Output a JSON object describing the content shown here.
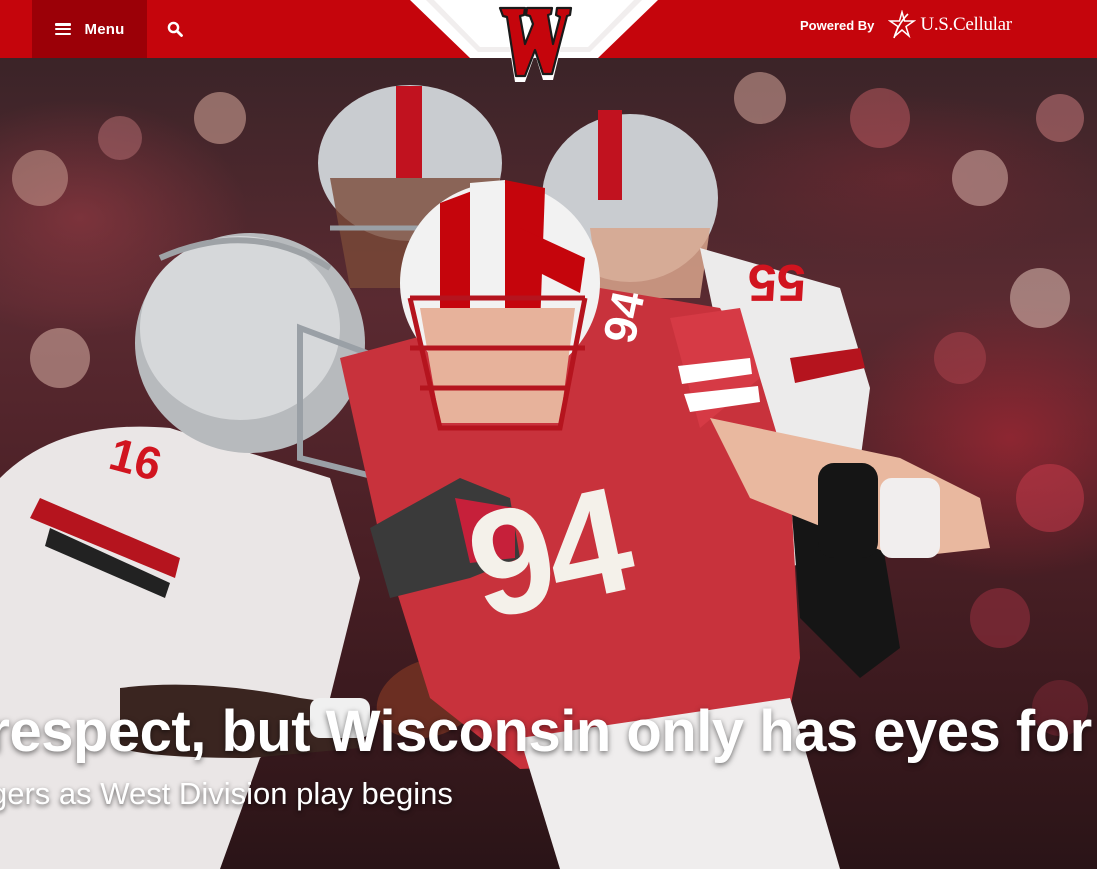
{
  "header": {
    "menu_label": "Menu",
    "search_icon": "search-icon",
    "logo_icon": "motion-w-logo-icon",
    "powered_by_label": "Powered By",
    "sponsor_name": "U.S.Cellular",
    "sponsor_icon": "uscellular-star-icon",
    "brand_color": "#c5050c",
    "menu_bg_color": "#9b0007"
  },
  "hero": {
    "headline": "y respect, but Wisconsin only has eyes for",
    "subheadline": "gers as West Division play begins",
    "jersey_number_main": "94",
    "jersey_number_sleeve": "94",
    "opponent_number_left": "16",
    "opponent_number_right": "55"
  }
}
